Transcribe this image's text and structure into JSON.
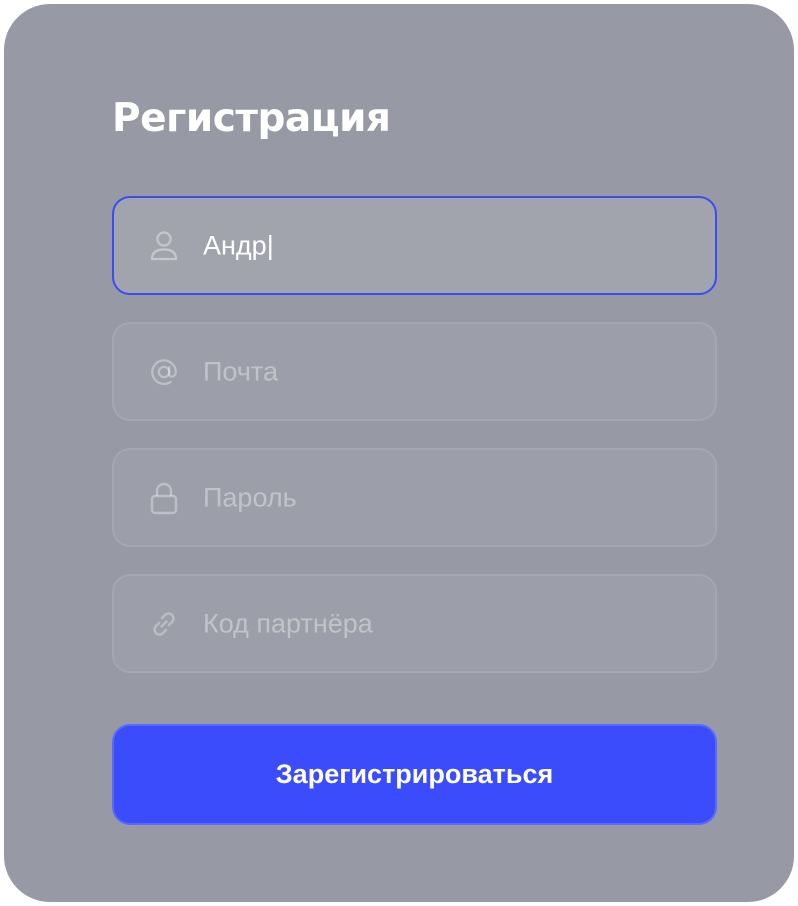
{
  "form": {
    "title": "Регистрация",
    "fields": [
      {
        "icon": "user-icon",
        "value": "Андр",
        "caret": "|",
        "active": true
      },
      {
        "icon": "at-sign-icon",
        "placeholder": "Почта"
      },
      {
        "icon": "lock-icon",
        "placeholder": "Пароль"
      },
      {
        "icon": "link-icon",
        "placeholder": "Код партнёра"
      }
    ],
    "submit_label": "Зарегистрироваться"
  },
  "colors": {
    "card_background": "#979aa4",
    "accent": "#3a4cfc",
    "focus_border": "#3a4cf6",
    "text": "#ffffff"
  }
}
